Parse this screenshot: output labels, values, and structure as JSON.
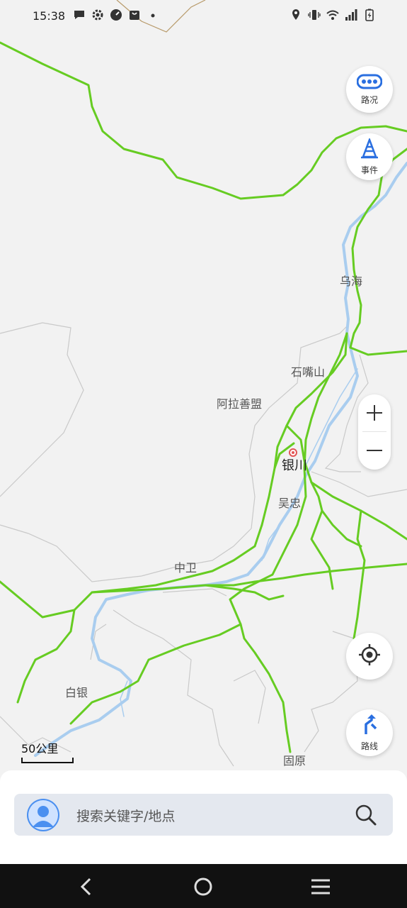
{
  "status_bar": {
    "time": "15:38",
    "left_icons": [
      "chat-icon",
      "settings-icon",
      "speed-icon",
      "bag-icon",
      "dot-icon"
    ],
    "right_icons": [
      "location-icon",
      "vibrate-icon",
      "wifi-icon",
      "signal-icon",
      "battery-charging-icon"
    ]
  },
  "map": {
    "places": {
      "wuhai": "乌海",
      "shizuishan": "石嘴山",
      "alashan": "阿拉善盟",
      "yinchuan": "银川",
      "wuzhong": "吴忠",
      "zhongwei": "中卫",
      "baiyin": "白银",
      "guyuan": "固原"
    },
    "colors": {
      "road": "#66cc22",
      "river": "#a9cdef",
      "border": "#c8c8c8",
      "background": "#f2f2f2"
    }
  },
  "controls": {
    "traffic_label": "路况",
    "events_label": "事件",
    "route_label": "路线",
    "zoom_in": "+",
    "zoom_out": "−"
  },
  "scale": {
    "label": "50公里"
  },
  "search": {
    "placeholder": "搜索关键字/地点"
  },
  "nav": {
    "back": "back-icon",
    "home": "home-icon",
    "menu": "menu-icon"
  }
}
